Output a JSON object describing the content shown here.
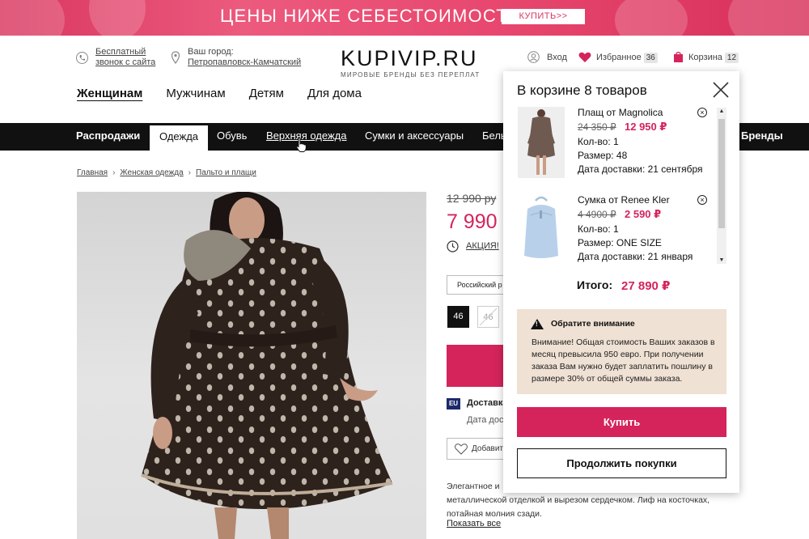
{
  "promo": {
    "title": "ЦЕНЫ НИЖЕ СЕБЕСТОИМОСТИ",
    "button": "КУПИТЬ>>"
  },
  "header": {
    "callback_line1": "Бесплатный",
    "callback_line2": "звонок с сайта",
    "city_label": "Ваш город:",
    "city_value": "Петропавловск-Камчатский",
    "logo": "KUPIVIP.RU",
    "logo_tagline": "МИРОВЫЕ БРЕНДЫ БЕЗ ПЕРЕПЛАТ",
    "login": "Вход",
    "favorites": "Избранное",
    "favorites_count": "36",
    "cart": "Корзина",
    "cart_count": "12"
  },
  "categories": [
    "Женщинам",
    "Мужчинам",
    "Детям",
    "Для дома"
  ],
  "nav": {
    "items": [
      "Распродажи",
      "Одежда",
      "Обувь",
      "Верхняя одежда",
      "Сумки и аксессуары",
      "Бель",
      "Бренды"
    ]
  },
  "breadcrumbs": [
    "Главная",
    "Женская одежда",
    "Пальто и плащи"
  ],
  "product": {
    "old_price": "12 990 ру",
    "new_price": "7 990",
    "promo_link": "АКЦИЯ!",
    "size_selector": "Российский р",
    "sizes": [
      "46",
      "46"
    ],
    "delivery": "Доставка",
    "delivery_date": "Дата достав",
    "favorite_button": "Добавит",
    "description": "Элегантное и металлической отделкой и вырезом сердечком. Лиф на косточках, потайная молния сзади.",
    "desc_line1": "Элегантное и",
    "desc_line2": "металлической отделкой и вырезом сердечком. Лиф на косточках,",
    "desc_line3": "потайная молния сзади.",
    "show_all": "Показать все"
  },
  "cart_popup": {
    "title": "В корзине 8 товаров",
    "items": [
      {
        "name": "Плащ от Magnolica",
        "old_price": "24 350 ₽",
        "new_price": "12 950 ₽",
        "qty": "Кол-во: 1",
        "size": "Размер: 48",
        "delivery": "Дата доставки: 21 сентября"
      },
      {
        "name": "Сумка от Renee Kler",
        "old_price": "4 4900 ₽",
        "new_price": "2 590 ₽",
        "qty": "Кол-во: 1",
        "size": "Размер: ONE SIZE",
        "delivery": "Дата доставки: 21 января"
      }
    ],
    "total_label": "Итого:",
    "total_value": "27 890 ₽",
    "notice_title": "Обратите внимание",
    "notice_body": "Внимание! Общая стоимость Ваших заказов в месяц превысила 950 евро. При получении заказа Вам нужно будет заплатить пошлину в размере 30% от общей суммы заказа.",
    "buy_button": "Купить",
    "continue_button": "Продолжить покупки"
  },
  "colors": {
    "accent": "#d4245b",
    "nav_bg": "#111111",
    "notice_bg": "#efe1d3"
  }
}
